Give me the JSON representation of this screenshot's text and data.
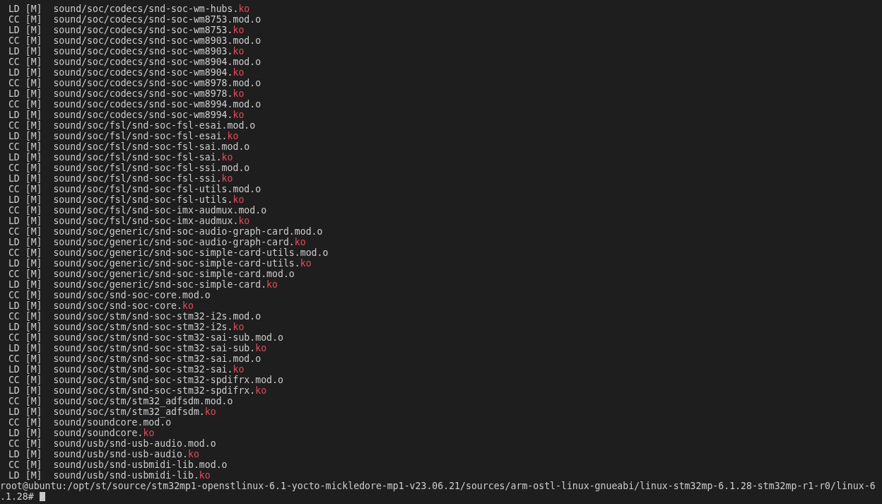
{
  "terminal": {
    "lines": [
      {
        "step": "LD",
        "flag": "[M]",
        "path": "sound/soc/codecs/snd-soc-wm-hubs.",
        "suffix": "ko"
      },
      {
        "step": "CC",
        "flag": "[M]",
        "path": "sound/soc/codecs/snd-soc-wm8753.mod.o"
      },
      {
        "step": "LD",
        "flag": "[M]",
        "path": "sound/soc/codecs/snd-soc-wm8753.",
        "suffix": "ko"
      },
      {
        "step": "CC",
        "flag": "[M]",
        "path": "sound/soc/codecs/snd-soc-wm8903.mod.o"
      },
      {
        "step": "LD",
        "flag": "[M]",
        "path": "sound/soc/codecs/snd-soc-wm8903.",
        "suffix": "ko"
      },
      {
        "step": "CC",
        "flag": "[M]",
        "path": "sound/soc/codecs/snd-soc-wm8904.mod.o"
      },
      {
        "step": "LD",
        "flag": "[M]",
        "path": "sound/soc/codecs/snd-soc-wm8904.",
        "suffix": "ko"
      },
      {
        "step": "CC",
        "flag": "[M]",
        "path": "sound/soc/codecs/snd-soc-wm8978.mod.o"
      },
      {
        "step": "LD",
        "flag": "[M]",
        "path": "sound/soc/codecs/snd-soc-wm8978.",
        "suffix": "ko"
      },
      {
        "step": "CC",
        "flag": "[M]",
        "path": "sound/soc/codecs/snd-soc-wm8994.mod.o"
      },
      {
        "step": "LD",
        "flag": "[M]",
        "path": "sound/soc/codecs/snd-soc-wm8994.",
        "suffix": "ko"
      },
      {
        "step": "CC",
        "flag": "[M]",
        "path": "sound/soc/fsl/snd-soc-fsl-esai.mod.o"
      },
      {
        "step": "LD",
        "flag": "[M]",
        "path": "sound/soc/fsl/snd-soc-fsl-esai.",
        "suffix": "ko"
      },
      {
        "step": "CC",
        "flag": "[M]",
        "path": "sound/soc/fsl/snd-soc-fsl-sai.mod.o"
      },
      {
        "step": "LD",
        "flag": "[M]",
        "path": "sound/soc/fsl/snd-soc-fsl-sai.",
        "suffix": "ko"
      },
      {
        "step": "CC",
        "flag": "[M]",
        "path": "sound/soc/fsl/snd-soc-fsl-ssi.mod.o"
      },
      {
        "step": "LD",
        "flag": "[M]",
        "path": "sound/soc/fsl/snd-soc-fsl-ssi.",
        "suffix": "ko"
      },
      {
        "step": "CC",
        "flag": "[M]",
        "path": "sound/soc/fsl/snd-soc-fsl-utils.mod.o"
      },
      {
        "step": "LD",
        "flag": "[M]",
        "path": "sound/soc/fsl/snd-soc-fsl-utils.",
        "suffix": "ko"
      },
      {
        "step": "CC",
        "flag": "[M]",
        "path": "sound/soc/fsl/snd-soc-imx-audmux.mod.o"
      },
      {
        "step": "LD",
        "flag": "[M]",
        "path": "sound/soc/fsl/snd-soc-imx-audmux.",
        "suffix": "ko"
      },
      {
        "step": "CC",
        "flag": "[M]",
        "path": "sound/soc/generic/snd-soc-audio-graph-card.mod.o"
      },
      {
        "step": "LD",
        "flag": "[M]",
        "path": "sound/soc/generic/snd-soc-audio-graph-card.",
        "suffix": "ko"
      },
      {
        "step": "CC",
        "flag": "[M]",
        "path": "sound/soc/generic/snd-soc-simple-card-utils.mod.o"
      },
      {
        "step": "LD",
        "flag": "[M]",
        "path": "sound/soc/generic/snd-soc-simple-card-utils.",
        "suffix": "ko"
      },
      {
        "step": "CC",
        "flag": "[M]",
        "path": "sound/soc/generic/snd-soc-simple-card.mod.o"
      },
      {
        "step": "LD",
        "flag": "[M]",
        "path": "sound/soc/generic/snd-soc-simple-card.",
        "suffix": "ko"
      },
      {
        "step": "CC",
        "flag": "[M]",
        "path": "sound/soc/snd-soc-core.mod.o"
      },
      {
        "step": "LD",
        "flag": "[M]",
        "path": "sound/soc/snd-soc-core.",
        "suffix": "ko"
      },
      {
        "step": "CC",
        "flag": "[M]",
        "path": "sound/soc/stm/snd-soc-stm32-i2s.mod.o"
      },
      {
        "step": "LD",
        "flag": "[M]",
        "path": "sound/soc/stm/snd-soc-stm32-i2s.",
        "suffix": "ko"
      },
      {
        "step": "CC",
        "flag": "[M]",
        "path": "sound/soc/stm/snd-soc-stm32-sai-sub.mod.o"
      },
      {
        "step": "LD",
        "flag": "[M]",
        "path": "sound/soc/stm/snd-soc-stm32-sai-sub.",
        "suffix": "ko"
      },
      {
        "step": "CC",
        "flag": "[M]",
        "path": "sound/soc/stm/snd-soc-stm32-sai.mod.o"
      },
      {
        "step": "LD",
        "flag": "[M]",
        "path": "sound/soc/stm/snd-soc-stm32-sai.",
        "suffix": "ko"
      },
      {
        "step": "CC",
        "flag": "[M]",
        "path": "sound/soc/stm/snd-soc-stm32-spdifrx.mod.o"
      },
      {
        "step": "LD",
        "flag": "[M]",
        "path": "sound/soc/stm/snd-soc-stm32-spdifrx.",
        "suffix": "ko"
      },
      {
        "step": "CC",
        "flag": "[M]",
        "path": "sound/soc/stm/stm32_adfsdm.mod.o"
      },
      {
        "step": "LD",
        "flag": "[M]",
        "path": "sound/soc/stm/stm32_adfsdm.",
        "suffix": "ko"
      },
      {
        "step": "CC",
        "flag": "[M]",
        "path": "sound/soundcore.mod.o"
      },
      {
        "step": "LD",
        "flag": "[M]",
        "path": "sound/soundcore.",
        "suffix": "ko"
      },
      {
        "step": "CC",
        "flag": "[M]",
        "path": "sound/usb/snd-usb-audio.mod.o"
      },
      {
        "step": "LD",
        "flag": "[M]",
        "path": "sound/usb/snd-usb-audio.",
        "suffix": "ko"
      },
      {
        "step": "CC",
        "flag": "[M]",
        "path": "sound/usb/snd-usbmidi-lib.mod.o"
      },
      {
        "step": "LD",
        "flag": "[M]",
        "path": "sound/usb/snd-usbmidi-lib.",
        "suffix": "ko"
      }
    ],
    "prompt": {
      "text": "root@ubuntu:/opt/st/source/stm32mp1-openstlinux-6.1-yocto-mickledore-mp1-v23.06.21/sources/arm-ostl-linux-gnueabi/linux-stm32mp-6.1.28-stm32mp-r1-r0/linux-6.1.28#",
      "cursor": true
    }
  }
}
